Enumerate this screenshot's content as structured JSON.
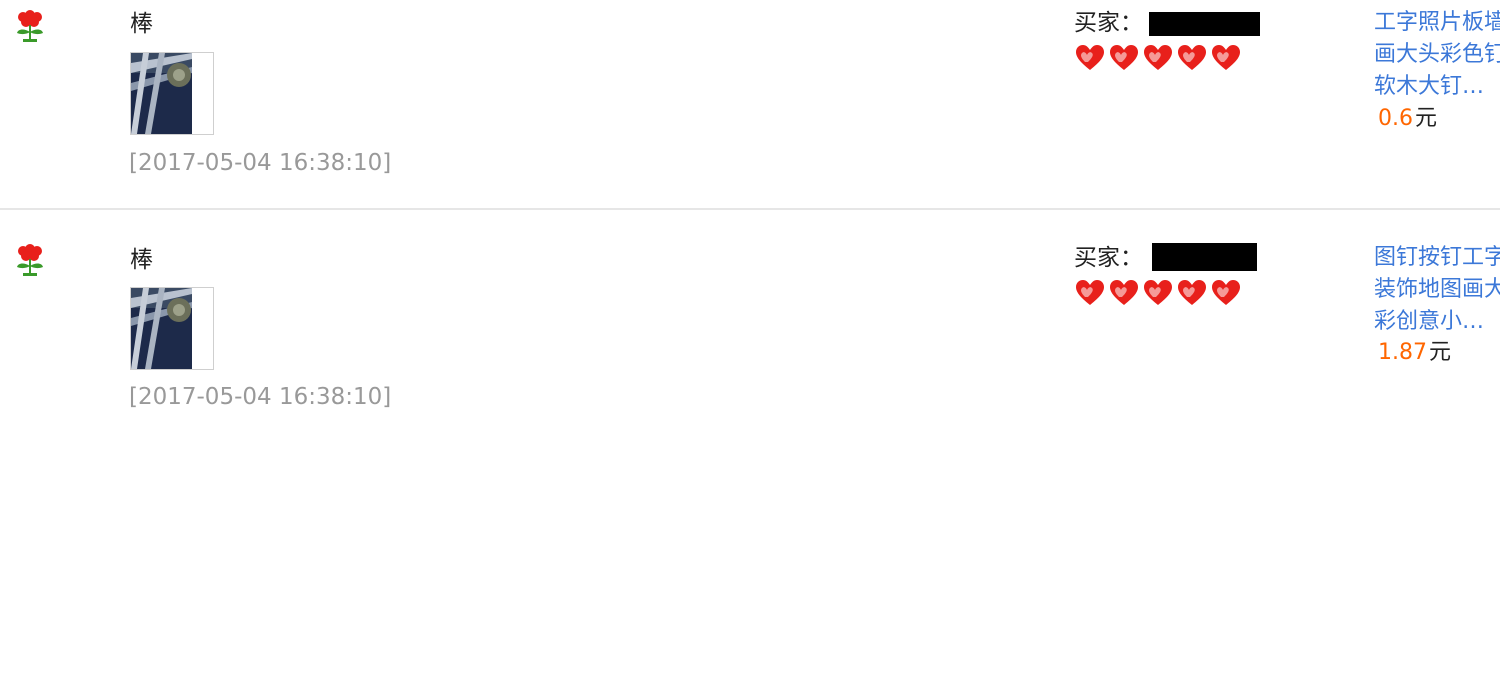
{
  "reviews": [
    {
      "rating_icon": "flower-icon",
      "comment": "棒",
      "photo_icon": "photo-thumbnail",
      "time": "[2017-05-04 16:38:10]",
      "buyer_label": "买家：",
      "buyer_name_redacted": true,
      "rank_icons": [
        "heart-icon",
        "heart-icon",
        "heart-icon",
        "heart-icon",
        "heart-icon"
      ],
      "product": {
        "lines": [
          "工字照片板墙",
          "画大头彩色钉",
          "软木大钉…"
        ],
        "price": "0.6",
        "unit": "元"
      }
    },
    {
      "rating_icon": "flower-icon",
      "comment": "棒",
      "photo_icon": "photo-thumbnail",
      "time": "[2017-05-04 16:38:10]",
      "buyer_label": "买家：",
      "buyer_name_redacted": true,
      "rank_icons": [
        "heart-icon",
        "heart-icon",
        "heart-icon",
        "heart-icon",
        "heart-icon"
      ],
      "product": {
        "lines": [
          "图钉按钉工字",
          "装饰地图画大",
          "彩创意小…"
        ],
        "price": "1.87",
        "unit": "元"
      }
    }
  ],
  "colors": {
    "link": "#3c78d8",
    "price": "#ff6600",
    "time": "#999999",
    "heart": "#e8201b",
    "divider": "#e6e6e6"
  }
}
